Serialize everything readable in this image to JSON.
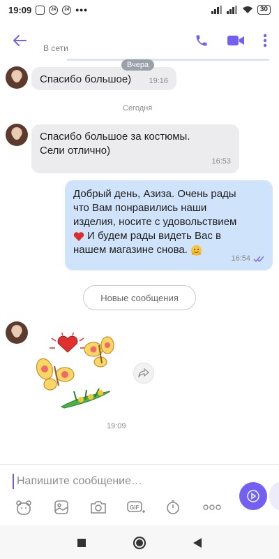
{
  "status_bar": {
    "time": "19:09",
    "battery": "30"
  },
  "header": {
    "status": "В сети"
  },
  "messages": {
    "m1": {
      "text": "Спасибо большое)",
      "time": "19:16",
      "date_badge": "Вчера"
    },
    "date_divider": "Сегодня",
    "m2": {
      "line1": "Спасибо большое за костюмы.",
      "line2": "Сели отлично)",
      "time": "16:53"
    },
    "m3": {
      "line1": "Добрый день, Азиза. Очень рады",
      "line2": "что Вам понравились наши",
      "line3": "изделия, носите с удовольствием",
      "line4": "И будем рады видеть Вас в",
      "line5": "нашем магазине снова.",
      "time": "16:54"
    },
    "new_messages": "Новые сообщения",
    "sticker_time": "19:09"
  },
  "composer": {
    "placeholder": "Напишите сообщение…"
  },
  "colors": {
    "accent": "#7360f2",
    "outgoing": "#cfe3fb",
    "incoming": "#ececef"
  }
}
